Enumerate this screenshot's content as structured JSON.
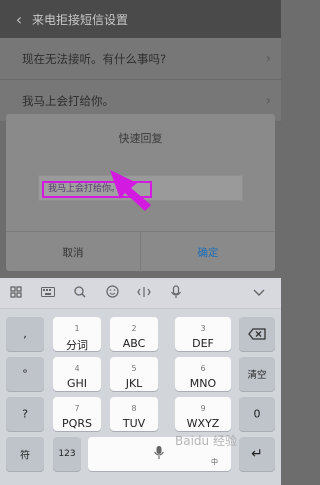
{
  "topbar": {
    "back_icon": "‹",
    "title": "来电拒接短信设置"
  },
  "list": {
    "items": [
      {
        "text": "现在无法接听。有什么事吗?"
      },
      {
        "text": "我马上会打给你。"
      }
    ],
    "chevron": "›"
  },
  "dialog": {
    "title": "快速回复",
    "input_value": "我马上会打给你。",
    "cancel_label": "取消",
    "confirm_label": "确定",
    "highlight_color": "#d21ae0"
  },
  "keyboard_toolbar": {
    "icons": [
      "grid-icon",
      "keyboard-icon",
      "search-icon",
      "emoji-icon",
      "cursor-icon",
      "mic-icon",
      "chevron-down-icon"
    ]
  },
  "keyboard": {
    "left_column": [
      ",",
      "°",
      "?",
      "!"
    ],
    "keys": [
      {
        "sub": "1",
        "main": "分词"
      },
      {
        "sub": "2",
        "main": "ABC"
      },
      {
        "sub": "3",
        "main": "DEF"
      },
      {
        "sub": "4",
        "main": "GHI"
      },
      {
        "sub": "5",
        "main": "JKL"
      },
      {
        "sub": "6",
        "main": "MNO"
      },
      {
        "sub": "7",
        "main": "PQRS"
      },
      {
        "sub": "8",
        "main": "TUV"
      },
      {
        "sub": "9",
        "main": "WXYZ"
      }
    ],
    "clear_label": "清空",
    "zero_label": "0",
    "symbol_label": "符",
    "num_label": "123",
    "lang_label": "中",
    "enter_label": "↵"
  },
  "watermark": "Baidu 经验"
}
